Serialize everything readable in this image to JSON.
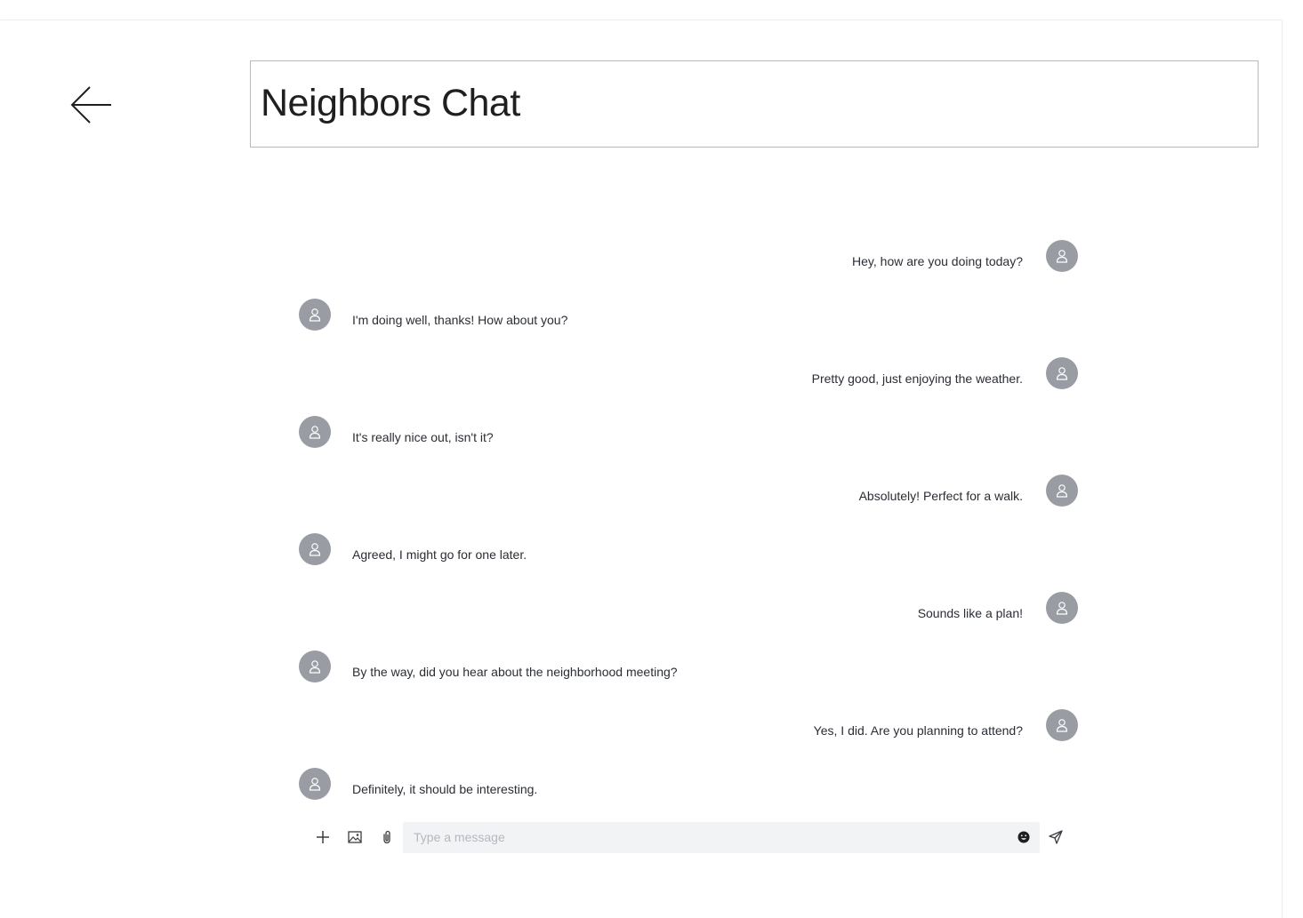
{
  "header": {
    "title": "Neighbors Chat",
    "back_icon": "arrow-left-icon"
  },
  "messages": [
    {
      "side": "right",
      "text": "Hey, how are you doing today?"
    },
    {
      "side": "left",
      "text": "I'm doing well, thanks! How about you?"
    },
    {
      "side": "right",
      "text": "Pretty good, just enjoying the weather."
    },
    {
      "side": "left",
      "text": "It's really nice out, isn't it?"
    },
    {
      "side": "right",
      "text": "Absolutely! Perfect for a walk."
    },
    {
      "side": "left",
      "text": "Agreed, I might go for one later."
    },
    {
      "side": "right",
      "text": "Sounds like a plan!"
    },
    {
      "side": "left",
      "text": "By the way, did you hear about the neighborhood meeting?"
    },
    {
      "side": "right",
      "text": "Yes, I did. Are you planning to attend?"
    },
    {
      "side": "left",
      "text": "Definitely, it should be interesting."
    }
  ],
  "composer": {
    "placeholder": "Type a message",
    "value": "",
    "icons": [
      "plus-icon",
      "image-icon",
      "paperclip-icon",
      "emoji-icon",
      "send-icon"
    ]
  },
  "colors": {
    "avatar_bg": "#9a9ca3",
    "input_bg": "#f2f3f5",
    "text": "#2a2d33"
  }
}
